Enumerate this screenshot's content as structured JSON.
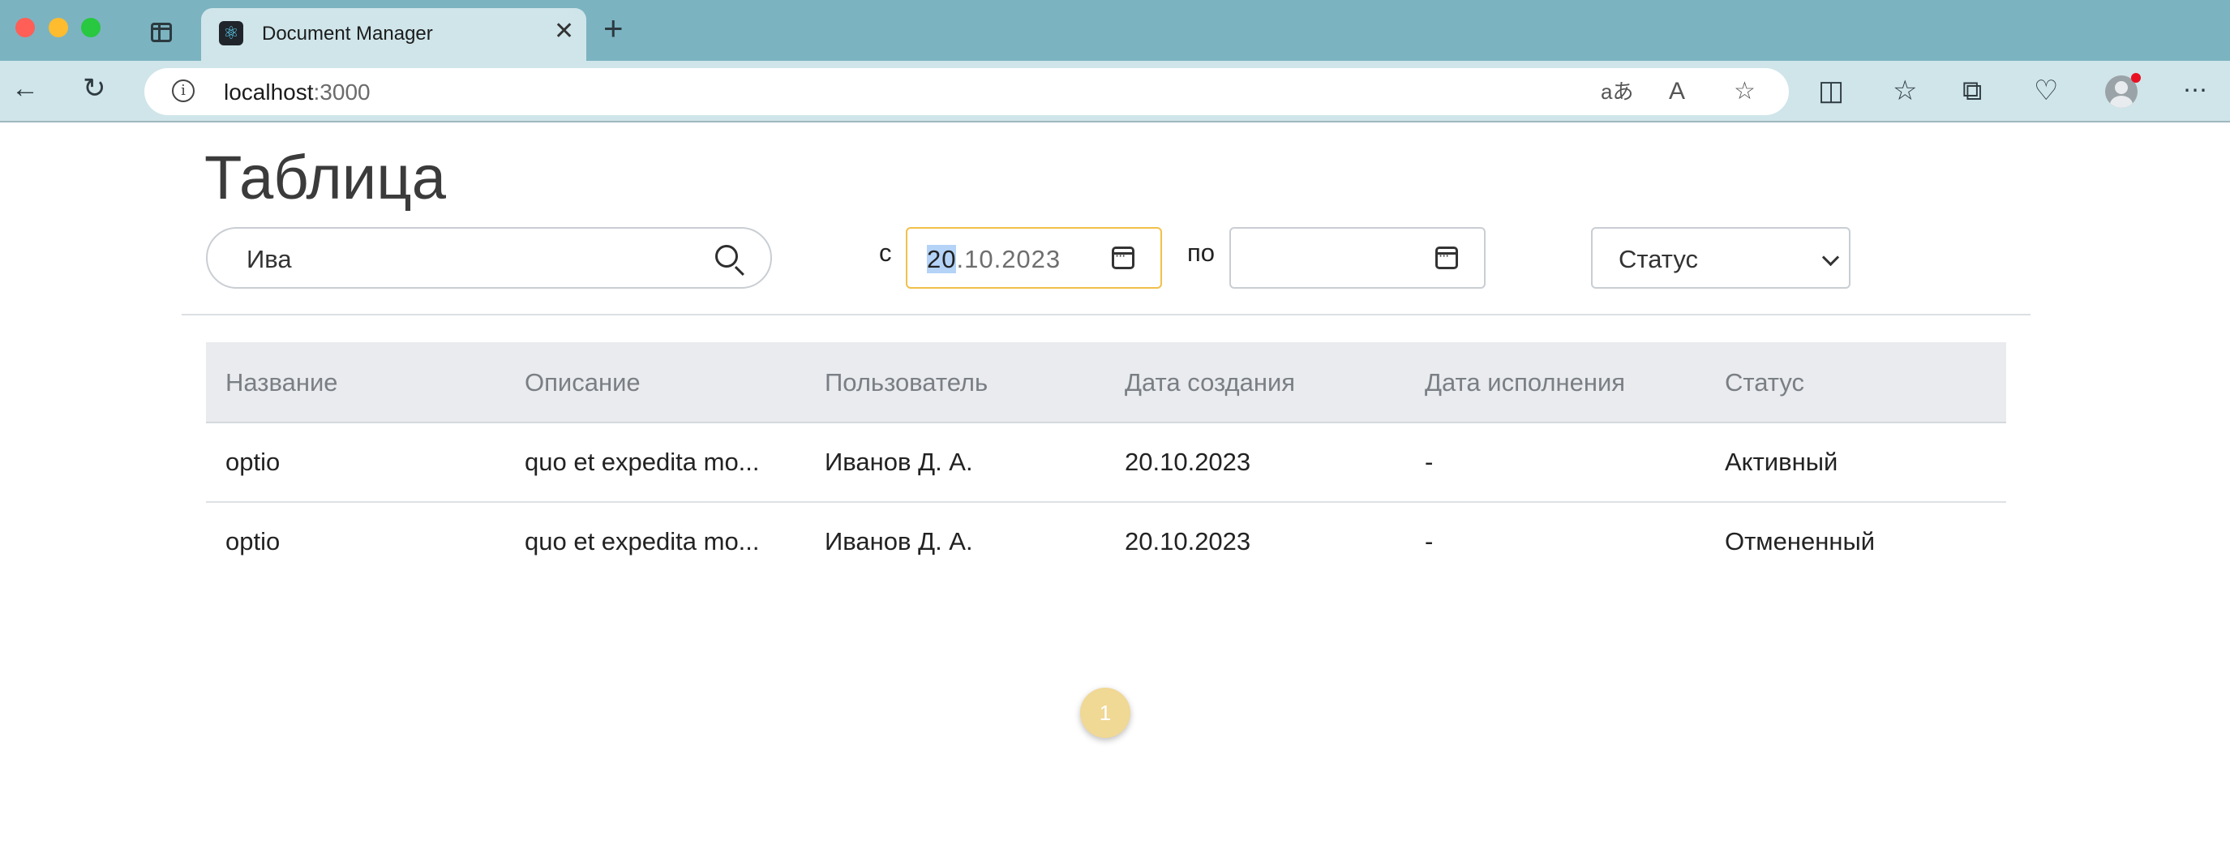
{
  "browser": {
    "tab_title": "Document Manager",
    "tab_close": "✕",
    "new_tab": "+",
    "address_host": "localhost",
    "address_port": ":3000",
    "icons": [
      "sidebar-tabs-icon",
      "back-icon",
      "reload-icon",
      "site-info-icon",
      "translate-icon",
      "read-aloud-icon",
      "favorite-star-icon",
      "split-screen-icon",
      "favorites-list-icon",
      "collections-icon",
      "browser-essentials-icon",
      "profile-avatar-icon",
      "more-menu-icon"
    ]
  },
  "page": {
    "title": "Таблица",
    "search": {
      "value": "Ива",
      "placeholder": ""
    },
    "from_label": "с",
    "from_date_highlight": "20",
    "from_date_rest": ".10.2023",
    "to_label": "по",
    "to_date": "",
    "status_select": "Статус"
  },
  "table": {
    "headers": [
      "Название",
      "Описание",
      "Пользователь",
      "Дата создания",
      "Дата исполнения",
      "Статус"
    ],
    "rows": [
      [
        "optio",
        "quo et expedita mo...",
        "Иванов Д. А.",
        "20.10.2023",
        "-",
        "Активный"
      ],
      [
        "optio",
        "quo et expedita mo...",
        "Иванов Д. А.",
        "20.10.2023",
        "-",
        "Отмененный"
      ]
    ]
  },
  "pagination": {
    "current": "1"
  },
  "colors": {
    "accent": "#f2c04a",
    "page_button": "#f0d895",
    "browser_bar": "#7cb3c1",
    "toolbar": "#cfe5ea"
  }
}
